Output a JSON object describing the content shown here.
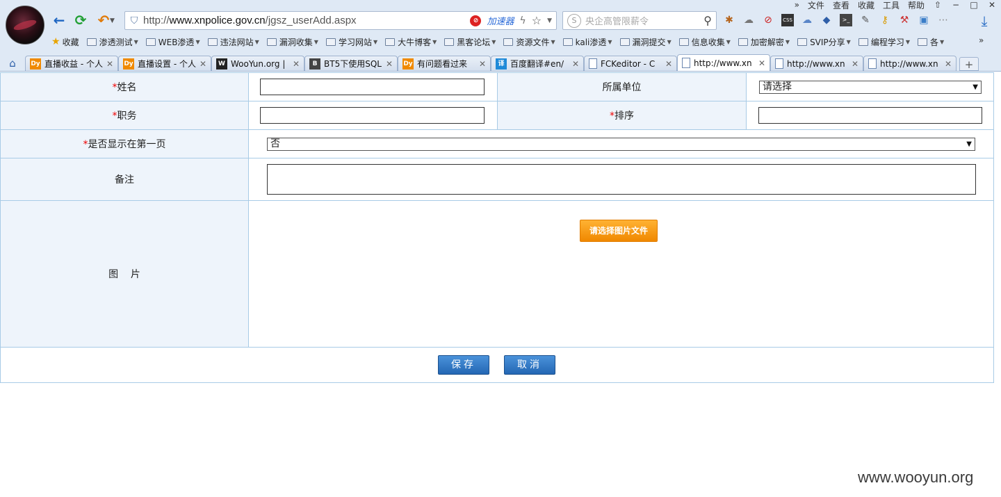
{
  "window": {
    "menu": [
      "文件",
      "查看",
      "收藏",
      "工具",
      "帮助"
    ],
    "more": "»"
  },
  "toolbar": {
    "url_prefix": "http://",
    "url_domain": "www.xnpolice.gov.cn",
    "url_path": "/jgsz_userAdd.aspx",
    "accelerator_label": "加速器",
    "search_placeholder": "央企高管限薪令"
  },
  "bookmarks": {
    "favorites": "收藏",
    "items": [
      "渗透测试",
      "WEB渗透",
      "违法网站",
      "漏洞收集",
      "学习网站",
      "大牛博客",
      "黑客论坛",
      "资源文件",
      "kali渗透",
      "漏洞提交",
      "信息收集",
      "加密解密",
      "SVIP分享",
      "编程学习",
      "各"
    ],
    "more": "»"
  },
  "tabs": [
    {
      "title": "直播收益 - 个人",
      "icon": "dy"
    },
    {
      "title": "直播设置 - 个人",
      "icon": "dy"
    },
    {
      "title": "WooYun.org |",
      "icon": "woo"
    },
    {
      "title": "BT5下使用SQL",
      "icon": "bt"
    },
    {
      "title": "有问题看过来",
      "icon": "dy"
    },
    {
      "title": "百度翻译#en/",
      "icon": "tr"
    },
    {
      "title": "FCKeditor - C",
      "icon": "doc"
    },
    {
      "title": "http://www.xn",
      "icon": "doc",
      "active": true
    },
    {
      "title": "http://www.xn",
      "icon": "doc"
    },
    {
      "title": "http://www.xn",
      "icon": "doc"
    }
  ],
  "form": {
    "required_mark": "*",
    "name_label": "姓名",
    "unit_label": "所属单位",
    "unit_value": "请选择",
    "position_label": "职务",
    "order_label": "排序",
    "show_first_label": "是否显示在第一页",
    "show_first_value": "否",
    "remark_label": "备注",
    "image_label": "图    片",
    "upload_button": "请选择图片文件",
    "save_button": "保存",
    "cancel_button": "取消"
  },
  "watermark": "www.wooyun.org",
  "colors": {
    "label_bg": "#eef4fb",
    "border": "#a8cbe6",
    "button_blue": "#2467b4",
    "upload_orange": "#f08800",
    "required": "#e00000"
  }
}
